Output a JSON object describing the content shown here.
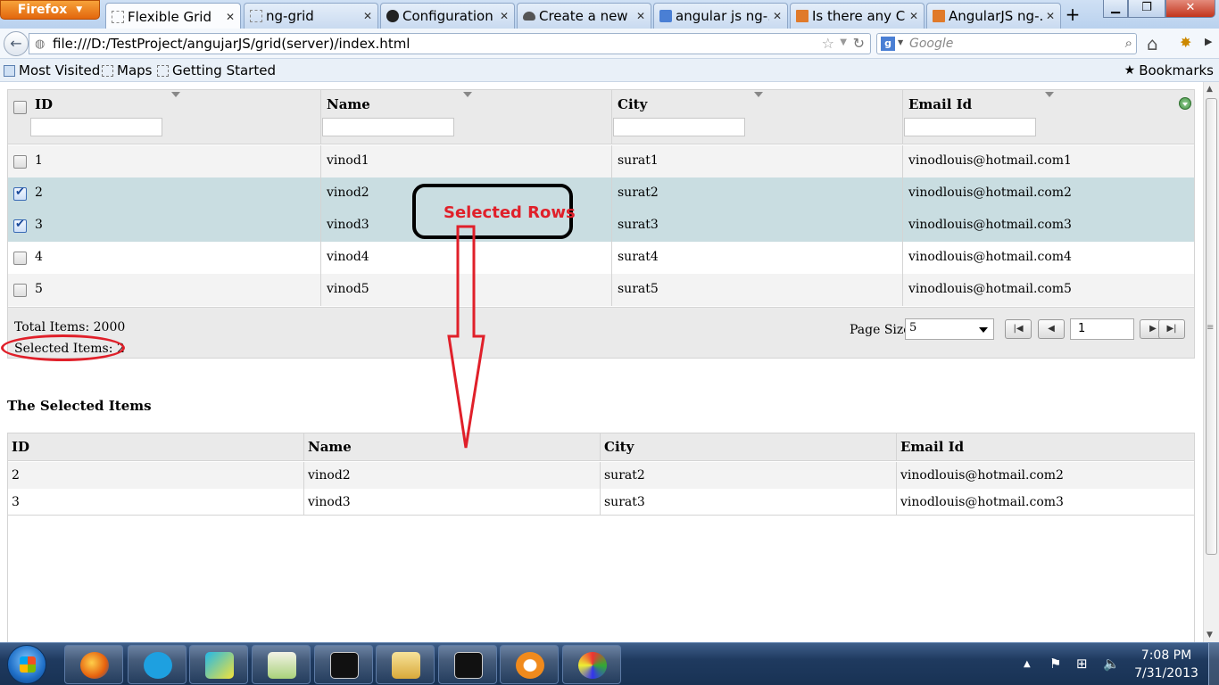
{
  "browser": {
    "app_button": "Firefox",
    "tabs": [
      {
        "label": "Flexible Grid",
        "icon": "blank-page-icon",
        "active": true
      },
      {
        "label": "ng-grid",
        "icon": "blank-page-icon"
      },
      {
        "label": "Configuration ...",
        "icon": "github-icon"
      },
      {
        "label": "Create a new F...",
        "icon": "cloud-icon"
      },
      {
        "label": "angular js ng-...",
        "icon": "google-icon"
      },
      {
        "label": "Is there any Ca...",
        "icon": "stackoverflow-icon"
      },
      {
        "label": "AngularJS ng-...",
        "icon": "stackoverflow-icon"
      }
    ],
    "new_tab": "+",
    "url": "file:///D:/TestProject/angujarJS/grid(server)/index.html",
    "search_engine": "g",
    "search_placeholder": "Google",
    "bookmarks_toolbar": [
      "Most Visited",
      "Maps",
      "Getting Started"
    ],
    "bookmarks_menu": "Bookmarks"
  },
  "grid": {
    "columns": [
      "ID",
      "Name",
      "City",
      "Email Id"
    ],
    "rows": [
      {
        "id": "1",
        "name": "vinod1",
        "city": "surat1",
        "email": "vinodlouis@hotmail.com1",
        "checked": false
      },
      {
        "id": "2",
        "name": "vinod2",
        "city": "surat2",
        "email": "vinodlouis@hotmail.com2",
        "checked": true
      },
      {
        "id": "3",
        "name": "vinod3",
        "city": "surat3",
        "email": "vinodlouis@hotmail.com3",
        "checked": true
      },
      {
        "id": "4",
        "name": "vinod4",
        "city": "surat4",
        "email": "vinodlouis@hotmail.com4",
        "checked": false
      },
      {
        "id": "5",
        "name": "vinod5",
        "city": "surat5",
        "email": "vinodlouis@hotmail.com5",
        "checked": false
      }
    ],
    "footer": {
      "total_items": "Total Items: 2000",
      "selected_items": "Selected Items: 2",
      "page_size_label": "Page Size:",
      "page_size_value": "5",
      "page_number": "1"
    },
    "colors": {
      "selected_row": "#c9dde1",
      "header": "#eaeaea"
    }
  },
  "selected_section": {
    "heading": "The Selected Items",
    "columns": [
      "ID",
      "Name",
      "City",
      "Email Id"
    ],
    "rows": [
      {
        "id": "2",
        "name": "vinod2",
        "city": "surat2",
        "email": "vinodlouis@hotmail.com2"
      },
      {
        "id": "3",
        "name": "vinod3",
        "city": "surat3",
        "email": "vinodlouis@hotmail.com3"
      }
    ]
  },
  "annotation": {
    "label": "Selected Rows",
    "color": "#e0202a"
  },
  "taskbar": {
    "time": "7:08 PM",
    "date": "7/31/2013",
    "pinned": [
      "firefox-icon",
      "skype-icon",
      "webstorm-icon",
      "notepad-plus-plus-icon",
      "cmd-icon",
      "explorer-icon",
      "cmd-icon",
      "media-player-icon",
      "paint-icon"
    ]
  }
}
